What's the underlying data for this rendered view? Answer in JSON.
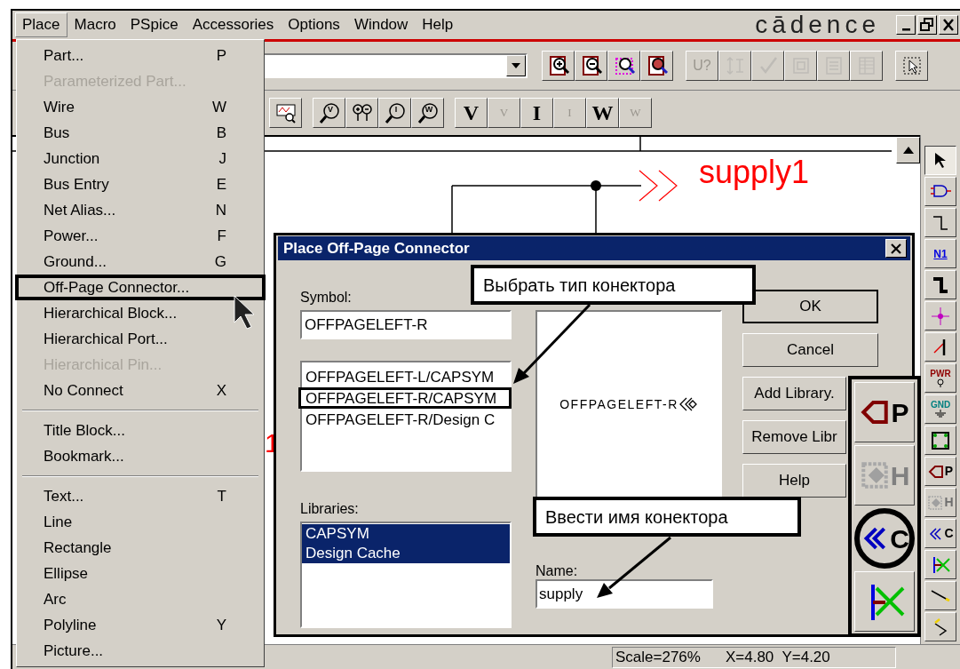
{
  "menu_bar": [
    {
      "label": "Place",
      "selected": true
    },
    {
      "label": "Macro",
      "selected": false
    },
    {
      "label": "PSpice",
      "selected": false
    },
    {
      "label": "Accessories",
      "selected": false
    },
    {
      "label": "Options",
      "selected": false
    },
    {
      "label": "Window",
      "selected": false
    },
    {
      "label": "Help",
      "selected": false
    }
  ],
  "brand": "cādence",
  "toolbar_top": [
    {
      "kind": "zoom_in",
      "disabled": false
    },
    {
      "kind": "zoom_out",
      "disabled": false
    },
    {
      "kind": "zoom_area",
      "disabled": false
    },
    {
      "kind": "zoom_all",
      "disabled": false
    },
    {
      "kind": "part_ref",
      "label": "U?",
      "disabled": true
    },
    {
      "kind": "annotate",
      "disabled": true
    },
    {
      "kind": "check",
      "disabled": true
    },
    {
      "kind": "netlist",
      "disabled": true
    },
    {
      "kind": "crossref",
      "disabled": true
    },
    {
      "kind": "bom",
      "disabled": true
    },
    {
      "kind": "select",
      "disabled": false
    }
  ],
  "toolbar_second": [
    {
      "kind": "markers",
      "disabled": false
    },
    {
      "kind": "probe",
      "label": "V",
      "disabled": false
    },
    {
      "kind": "diff_probe",
      "disabled": false
    },
    {
      "kind": "probe",
      "label": "I",
      "disabled": false
    },
    {
      "kind": "probe",
      "label": "W",
      "disabled": false
    },
    {
      "kind": "letter",
      "label": "V",
      "disabled": false
    },
    {
      "kind": "letter_arrow",
      "label": "V",
      "disabled": true
    },
    {
      "kind": "letter",
      "label": "I",
      "disabled": false
    },
    {
      "kind": "letter_arrow",
      "label": "I",
      "disabled": true
    },
    {
      "kind": "letter",
      "label": "W",
      "disabled": false
    },
    {
      "kind": "letter_arrow",
      "label": "W",
      "disabled": true
    }
  ],
  "place_menu": [
    [
      {
        "label": "Part...",
        "shortcut": "P",
        "disabled": false,
        "highlighted": false
      },
      {
        "label": "Parameterized Part...",
        "disabled": true,
        "highlighted": false
      },
      {
        "label": "Wire",
        "shortcut": "W",
        "disabled": false,
        "highlighted": false
      },
      {
        "label": "Bus",
        "shortcut": "B",
        "disabled": false,
        "highlighted": false
      },
      {
        "label": "Junction",
        "shortcut": "J",
        "disabled": false,
        "highlighted": false
      },
      {
        "label": "Bus Entry",
        "shortcut": "E",
        "disabled": false,
        "highlighted": false
      },
      {
        "label": "Net Alias...",
        "shortcut": "N",
        "disabled": false,
        "highlighted": false
      },
      {
        "label": "Power...",
        "shortcut": "F",
        "disabled": false,
        "highlighted": false
      },
      {
        "label": "Ground...",
        "shortcut": "G",
        "disabled": false,
        "highlighted": false
      },
      {
        "label": "Off-Page Connector...",
        "disabled": false,
        "highlighted": true
      },
      {
        "label": "Hierarchical Block...",
        "disabled": false,
        "highlighted": false
      },
      {
        "label": "Hierarchical Port...",
        "disabled": false,
        "highlighted": false
      },
      {
        "label": "Hierarchical Pin...",
        "disabled": true,
        "highlighted": false
      },
      {
        "label": "No Connect",
        "shortcut": "X",
        "disabled": false,
        "highlighted": false
      }
    ],
    [
      {
        "label": "Title Block...",
        "disabled": false,
        "highlighted": false
      },
      {
        "label": "Bookmark...",
        "disabled": false,
        "highlighted": false
      }
    ],
    [
      {
        "label": "Text...",
        "shortcut": "T",
        "disabled": false,
        "highlighted": false
      },
      {
        "label": "Line",
        "disabled": false,
        "highlighted": false
      },
      {
        "label": "Rectangle",
        "disabled": false,
        "highlighted": false
      },
      {
        "label": "Ellipse",
        "disabled": false,
        "highlighted": false
      },
      {
        "label": "Arc",
        "disabled": false,
        "highlighted": false
      },
      {
        "label": "Polyline",
        "shortcut": "Y",
        "disabled": false,
        "highlighted": false
      },
      {
        "label": "Picture...",
        "disabled": false,
        "highlighted": false
      }
    ]
  ],
  "schematic": {
    "net_label": "supply1",
    "fragment": "1"
  },
  "dialog": {
    "title": "Place Off-Page Connector",
    "symbol_label": "Symbol:",
    "symbol_value": "OFFPAGELEFT-R",
    "symbols": [
      {
        "label": "OFFPAGELEFT-L/CAPSYM",
        "selected": false
      },
      {
        "label": "OFFPAGELEFT-R/CAPSYM",
        "selected": true
      },
      {
        "label": "OFFPAGELEFT-R/Design C",
        "selected": false
      }
    ],
    "preview_label": "OFFPAGELEFT-R",
    "libraries_label": "Libraries:",
    "libraries": [
      {
        "label": "CAPSYM",
        "selected": true
      },
      {
        "label": "Design Cache",
        "selected": true
      }
    ],
    "name_label": "Name:",
    "name_value": "supply",
    "buttons": [
      "OK",
      "Cancel",
      "Add Library.",
      "Remove Libr",
      "Help"
    ]
  },
  "callouts": [
    "Выбрать тип конектора",
    "Ввести имя конектора"
  ],
  "zoomed_tools": [
    {
      "kind": "offpage_port",
      "label": "P",
      "circled": false
    },
    {
      "kind": "hier_port",
      "label": "H",
      "circled": false
    },
    {
      "kind": "offpage_connector",
      "label": "C",
      "circled": true
    },
    {
      "kind": "no_connect",
      "circled": false
    }
  ],
  "right_toolbar": [
    {
      "kind": "pointer",
      "selected": true
    },
    {
      "kind": "part",
      "selected": false
    },
    {
      "kind": "wire",
      "selected": false
    },
    {
      "kind": "net_alias",
      "label": "N1",
      "selected": false
    },
    {
      "kind": "bus",
      "selected": false
    },
    {
      "kind": "junction",
      "selected": false
    },
    {
      "kind": "bus_entry",
      "selected": false
    },
    {
      "kind": "power",
      "label": "PWR",
      "selected": false
    },
    {
      "kind": "ground",
      "label": "GND",
      "selected": false
    },
    {
      "kind": "hier_block",
      "selected": false
    },
    {
      "kind": "offpage_port",
      "label": "P",
      "selected": false
    },
    {
      "kind": "hier_port",
      "label": "H",
      "selected": false
    },
    {
      "kind": "offpage_connector",
      "label": "C",
      "selected": false
    },
    {
      "kind": "no_connect",
      "selected": false
    },
    {
      "kind": "line",
      "selected": false
    },
    {
      "kind": "polyline",
      "selected": false
    }
  ],
  "status_bar": [
    "Scale=276%",
    "X=4.80  Y=4.20"
  ]
}
